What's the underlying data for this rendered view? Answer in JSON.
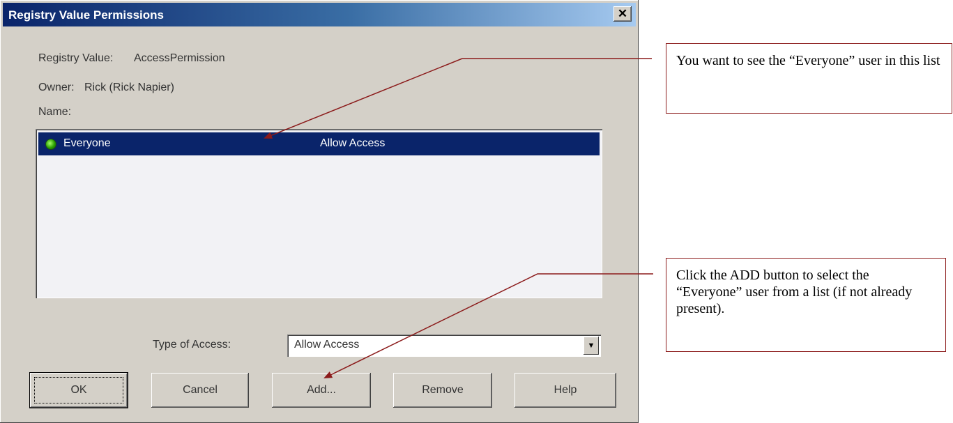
{
  "dialog": {
    "title": "Registry Value Permissions",
    "close_glyph": "✕",
    "registry_value_label": "Registry Value:",
    "registry_value": "AccessPermission",
    "owner_label": "Owner:",
    "owner_value": "Rick (Rick Napier)",
    "name_label": "Name:",
    "list": [
      {
        "name": "Everyone",
        "access": "Allow Access",
        "selected": true,
        "icon": "user-group-icon"
      }
    ],
    "type_of_access_label": "Type of Access:",
    "type_of_access_value": "Allow Access",
    "buttons": {
      "ok": "OK",
      "cancel": "Cancel",
      "add": "Add...",
      "remove": "Remove",
      "help": "Help"
    }
  },
  "callouts": [
    {
      "text": "You want to see the “Everyone” user in this list"
    },
    {
      "text": "Click the ADD button to select the “Everyone” user from a list (if not already present)."
    }
  ],
  "colors": {
    "titlebar_start": "#0a246a",
    "selection": "#0a246a",
    "annotation": "#8b1a1a",
    "dialog_bg": "#d4d0c8"
  }
}
